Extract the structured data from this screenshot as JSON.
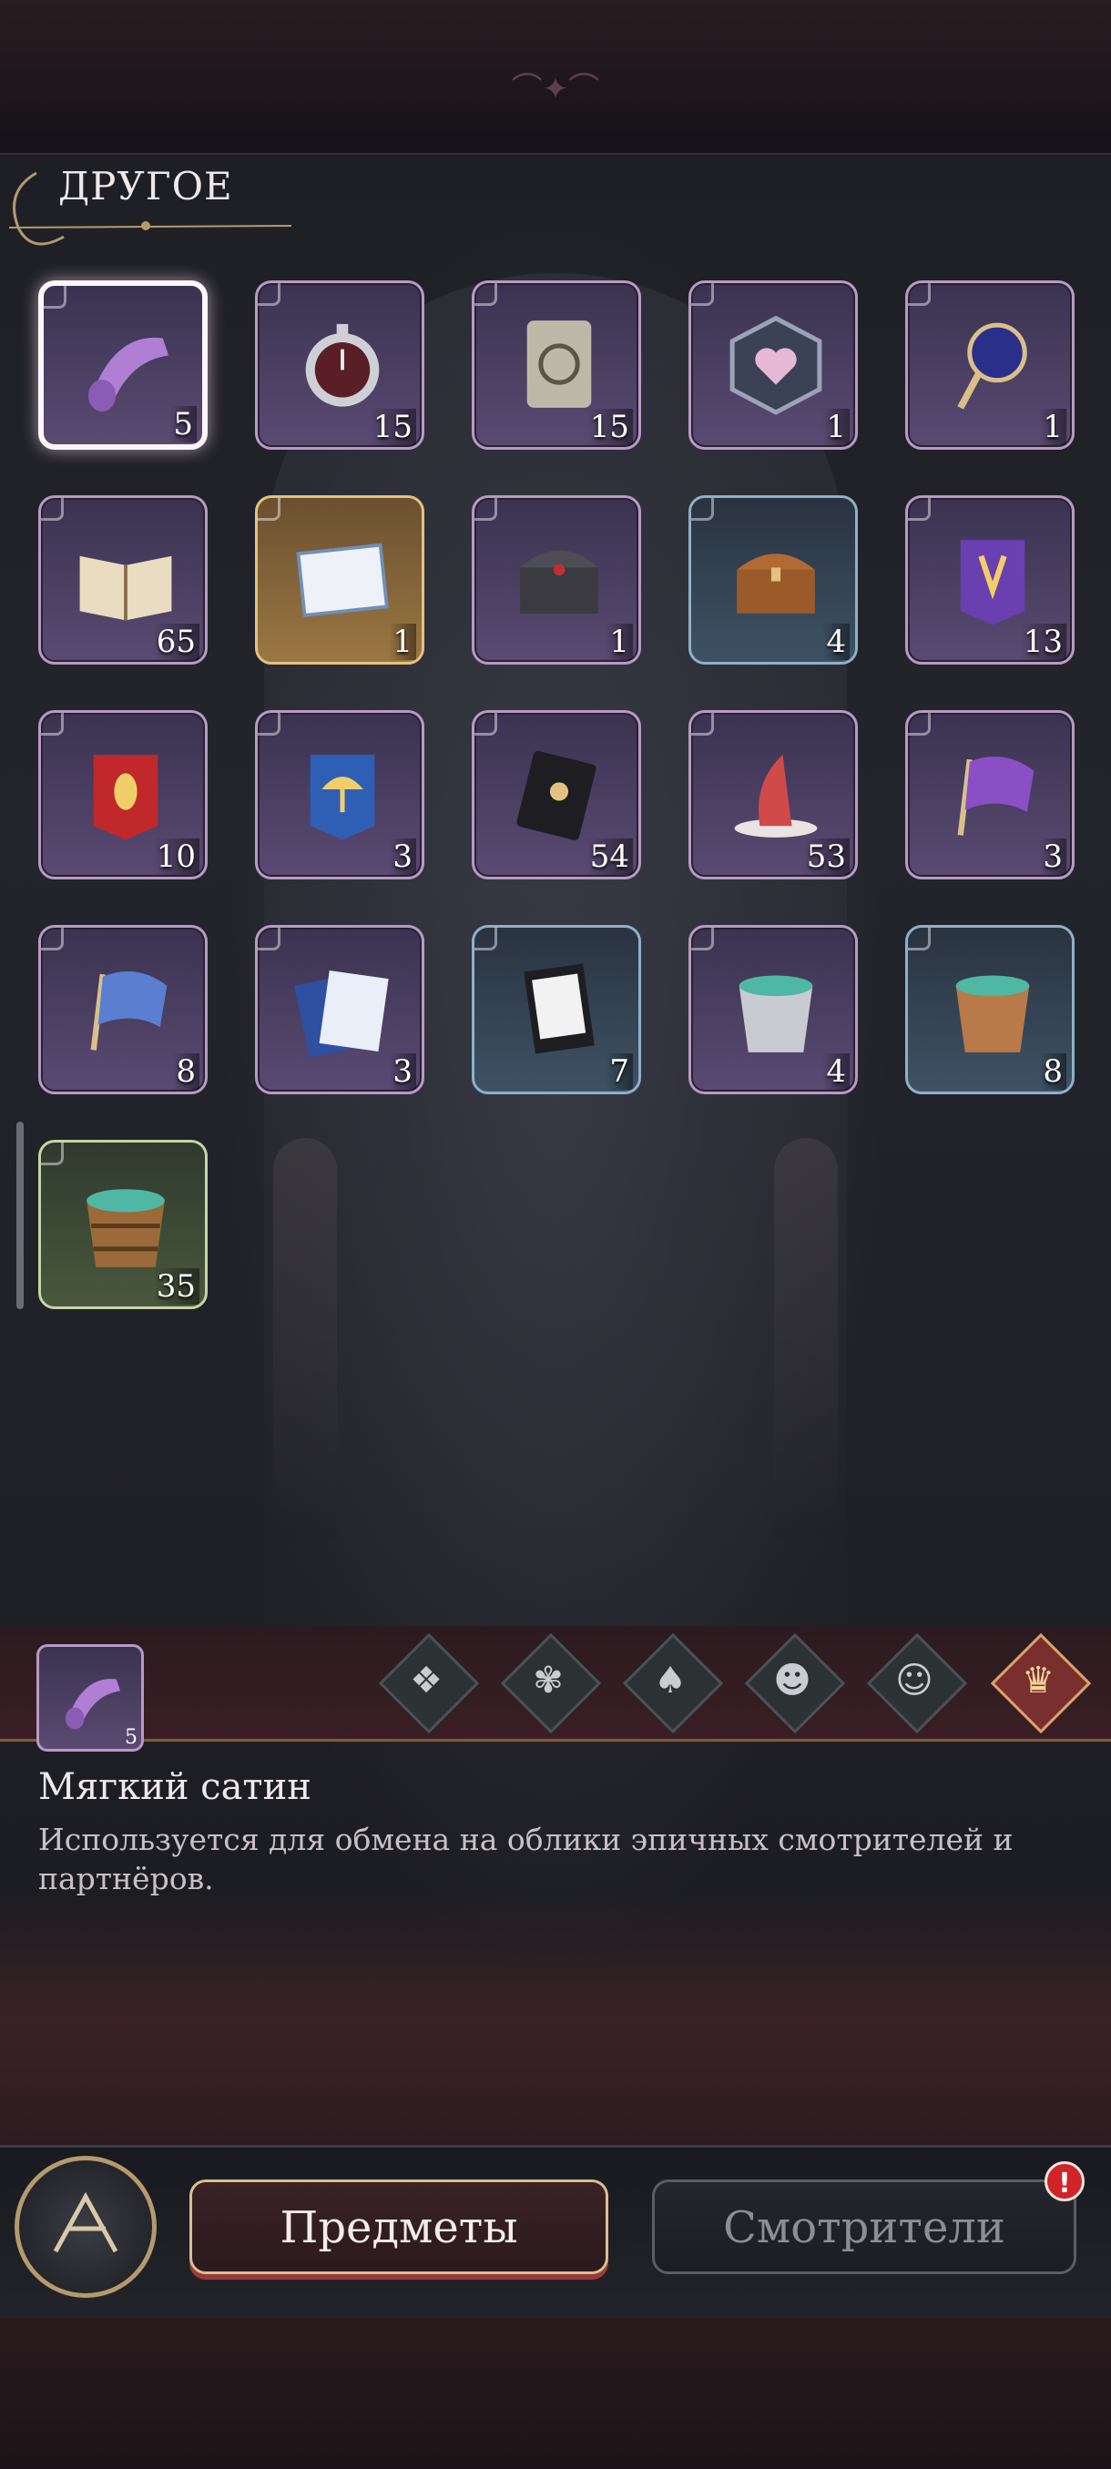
{
  "section": {
    "title": "ДРУГОЕ"
  },
  "items": [
    {
      "icon": "satin-roll-icon",
      "qty": "5",
      "rarity": "purple",
      "selected": true
    },
    {
      "icon": "pocket-watch-icon",
      "qty": "15",
      "rarity": "purple"
    },
    {
      "icon": "silver-card-icon",
      "qty": "15",
      "rarity": "purple"
    },
    {
      "icon": "heart-emblem-icon",
      "qty": "1",
      "rarity": "purple"
    },
    {
      "icon": "magnifier-icon",
      "qty": "1",
      "rarity": "purple"
    },
    {
      "icon": "open-book-icon",
      "qty": "65",
      "rarity": "purple"
    },
    {
      "icon": "certificate-icon",
      "qty": "1",
      "rarity": "gold"
    },
    {
      "icon": "dark-chest-icon",
      "qty": "1",
      "rarity": "purple"
    },
    {
      "icon": "wooden-chest-icon",
      "qty": "4",
      "rarity": "blue"
    },
    {
      "icon": "purple-banner-icon",
      "qty": "13",
      "rarity": "purple"
    },
    {
      "icon": "red-banner-icon",
      "qty": "10",
      "rarity": "purple"
    },
    {
      "icon": "blue-umbrella-banner-icon",
      "qty": "3",
      "rarity": "purple"
    },
    {
      "icon": "black-envelope-icon",
      "qty": "54",
      "rarity": "purple"
    },
    {
      "icon": "red-napkin-icon",
      "qty": "53",
      "rarity": "purple"
    },
    {
      "icon": "purple-flag-icon",
      "qty": "3",
      "rarity": "purple"
    },
    {
      "icon": "blue-flag-icon",
      "qty": "8",
      "rarity": "purple"
    },
    {
      "icon": "letters-icon",
      "qty": "3",
      "rarity": "purple"
    },
    {
      "icon": "menu-card-icon",
      "qty": "7",
      "rarity": "blue"
    },
    {
      "icon": "silver-bucket-icon",
      "qty": "4",
      "rarity": "purple"
    },
    {
      "icon": "copper-bucket-icon",
      "qty": "8",
      "rarity": "blue"
    },
    {
      "icon": "wooden-bucket-icon",
      "qty": "35",
      "rarity": "green"
    }
  ],
  "detail": {
    "qty": "5",
    "name": "Мягкий сатин",
    "description": "Используется для обмена на облики эпичных смотрителей и партнёров."
  },
  "filters": [
    {
      "icon": "grid-diamond-icon",
      "glyph": "❖",
      "active": false
    },
    {
      "icon": "bat-flower-icon",
      "glyph": "✾",
      "active": false
    },
    {
      "icon": "hooded-figure-icon",
      "glyph": "♠",
      "active": false
    },
    {
      "icon": "profile-head-icon",
      "glyph": "☻",
      "active": false
    },
    {
      "icon": "cat-face-icon",
      "glyph": "☺",
      "active": false
    },
    {
      "icon": "crown-bag-icon",
      "glyph": "♛",
      "active": true
    }
  ],
  "tabs": {
    "items": "Предметы",
    "keepers": "Смотрители"
  },
  "badge": "!",
  "colors": {
    "accent_gold": "#d9bf92",
    "badge_red": "#d0242a",
    "purple_rarity": "#b89ac4",
    "blue_rarity": "#8fb0c9",
    "gold_rarity": "#e3c281",
    "green_rarity": "#c6d5a4"
  }
}
